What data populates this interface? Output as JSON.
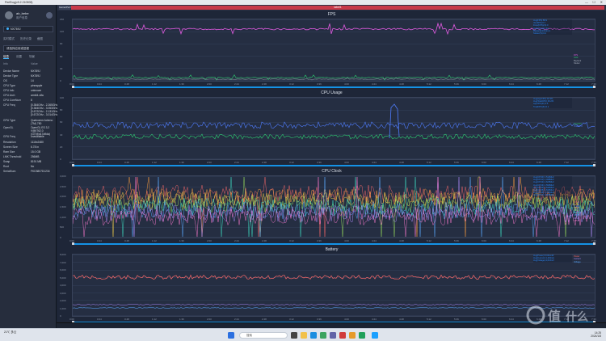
{
  "window": {
    "title": "PerfDog(v9.2.210908)"
  },
  "sidebar": {
    "user": "ab_bebe",
    "sub": "用户信息",
    "device": "NX769J",
    "nav": [
      "实时模式",
      "历史记录",
      "截图"
    ],
    "app": "请选择应用或进程",
    "tabs": [
      "信息",
      "设置",
      "场景"
    ],
    "header": [
      "Info",
      "Value"
    ],
    "rows": [
      {
        "k": "Device Name",
        "v": "NX769J"
      },
      {
        "k": "Device Type",
        "v": "NX769J"
      },
      {
        "k": "OS",
        "v": "14"
      },
      {
        "k": "CPU Type",
        "v": "pineapple"
      },
      {
        "k": "CPU Info",
        "v": "unknown"
      },
      {
        "k": "CPU Arch",
        "v": "arm64-v8a"
      },
      {
        "k": "CPU CoreNum",
        "v": "8"
      },
      {
        "k": "CPU Freq",
        "v": "[0.384GHz - 2.265GHz]\n[0.384GHz - 3.053GHz]\n[0.672GHz - 2.131GHz]\n[0.672GHz - 3.014GHz]"
      },
      {
        "k": "GPU Type",
        "v": "Qualcomm Adreno\n(TM) 750"
      },
      {
        "k": "OpenGL",
        "v": "OpenGL ES 3.2\nV@0762.0\n(GIT@d17a9da)"
      },
      {
        "k": "GPU Freq",
        "v": "unavailable"
      },
      {
        "k": "Resolution",
        "v": "1116x2480"
      },
      {
        "k": "Screen Size",
        "v": "6.78 in"
      },
      {
        "k": "Ram Size",
        "v": "15.0 GB"
      },
      {
        "k": "LMK Threshold",
        "v": "256MB"
      },
      {
        "k": "Swap",
        "v": "8191 MB"
      },
      {
        "k": "Root",
        "v": "No"
      },
      {
        "k": "SerialNum",
        "v": "FKD3807D1234"
      }
    ]
  },
  "main": {
    "tab": "Game/Perf",
    "redbar": "label1"
  },
  "charts": {
    "fps": {
      "title": "FPS",
      "yticks": [
        "150",
        "120",
        "90",
        "60",
        "30",
        "0"
      ],
      "xticks": [
        "0:00",
        "0:24",
        "0:48",
        "1:12",
        "1:36",
        "2:00",
        "2:24",
        "2:48",
        "3:12",
        "3:36",
        "4:00",
        "4:24",
        "4:48",
        "5:12",
        "5:36",
        "6:00",
        "6:24",
        "6:48",
        "7:12",
        "7:36"
      ],
      "legend": [
        "Avg(FPS):58.9",
        "Var(FPS):0.7",
        "Drop(FPS)(/h):0",
        "Jank(/10min):44",
        "BigJank(/10min):1",
        "Stutter(%):0.2"
      ],
      "side": [
        "FPS",
        "Jank",
        "BigJank",
        "Stutter"
      ],
      "sidecolors": [
        "#e05ae0",
        "#2ecc71",
        "#aab2c0",
        "#aab2c0"
      ]
    },
    "cpu": {
      "title": "CPU Usage",
      "yticks": [
        "100",
        "80",
        "60",
        "40",
        "20",
        "0"
      ],
      "xticks": [
        "0:00",
        "0:24",
        "0:48",
        "1:12",
        "1:36",
        "2:00",
        "2:24",
        "2:48",
        "3:12",
        "3:36",
        "4:00",
        "4:24",
        "4:48",
        "5:12",
        "5:36",
        "6:00",
        "6:24",
        "6:48",
        "7:12",
        "7:36"
      ],
      "legend": [
        "Avg(AppCPU):18.4%",
        "Avg(TotalCPU):30.2%",
        "AppCPU(/h):0.5",
        "TotalCPU(/h):0.1"
      ],
      "side": [
        "AppCPU",
        "TotalCPU"
      ],
      "sidecolors": [
        "#2ecc71",
        "#4f7dff"
      ]
    },
    "clock": {
      "title": "CPU Clock",
      "yticks": [
        "3,000",
        "2,500",
        "2,000",
        "1,500",
        "1,000",
        "500",
        "0"
      ],
      "xticks": [
        "0:00",
        "0:24",
        "0:48",
        "1:12",
        "1:36",
        "2:00",
        "2:24",
        "2:48",
        "3:12",
        "3:36",
        "4:00",
        "4:24",
        "4:48",
        "5:12",
        "5:36",
        "6:00",
        "6:24",
        "6:48",
        "7:12",
        "7:36"
      ],
      "legend": [
        "Avg(CPU0):1,512MHz",
        "Avg(CPU1):1,498MHz",
        "Avg(CPU2):1,620MHz",
        "Avg(CPU3):1,590MHz",
        "Avg(CPU4):1,644MHz",
        "Avg(CPU5):1,630MHz",
        "Avg(CPU6):1,702MHz",
        "Avg(CPU7):1,805MHz"
      ],
      "side": [
        "CPU0",
        "CPU1",
        "CPU2",
        "CPU3",
        "CPU4",
        "CPU5",
        "CPU6",
        "CPU7"
      ],
      "sidecolors": [
        "#ff6a6a",
        "#ff9f40",
        "#ffd84a",
        "#9be15d",
        "#3fe0c5",
        "#5aa9ff",
        "#b18cff",
        "#ff7bd0"
      ]
    },
    "battery": {
      "title": "Battery",
      "yticks": [
        "8,000",
        "7,000",
        "6,000",
        "5,000",
        "4,000",
        "3,000",
        "2,000",
        "1,000",
        "0"
      ],
      "xticks": [
        "0:00",
        "0:24",
        "0:48",
        "1:12",
        "1:36",
        "2:00",
        "2:24",
        "2:48",
        "3:12",
        "3:36",
        "4:00",
        "4:24",
        "4:48",
        "5:12",
        "5:36",
        "6:00",
        "6:24",
        "6:48",
        "7:12",
        "7:36"
      ],
      "legend": [
        "Avg(Power):5,631mW",
        "Avg(Current):1,402mA",
        "Avg(Voltage):4,016mV"
      ],
      "side": [
        "Power",
        "Current",
        "Voltage"
      ],
      "sidecolors": [
        "#ff6a6a",
        "#b18cff",
        "#5aa9ff"
      ]
    }
  },
  "taskbar": {
    "weather": "21℃ 多云",
    "search": "搜索",
    "time": "14:25",
    "date": "2024/1/8"
  },
  "watermark": "值 什么值得买"
}
